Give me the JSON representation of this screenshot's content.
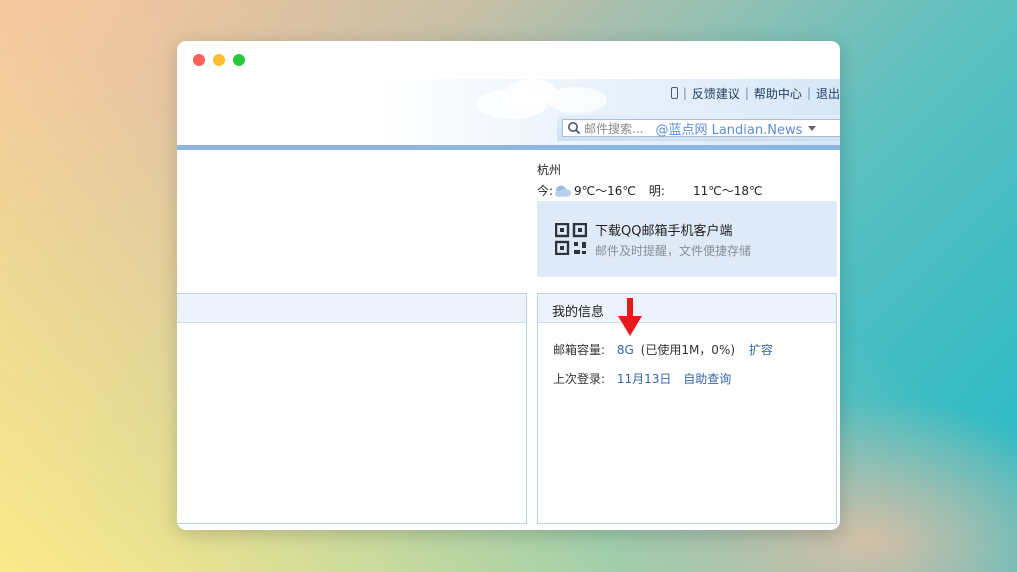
{
  "top_links": {
    "phone_icon": "phone-icon",
    "separator": "|",
    "feedback": "反馈建议",
    "help": "帮助中心",
    "logout": "退出"
  },
  "search": {
    "placeholder": "邮件搜索...",
    "watermark": "@蓝点网 Landian.News"
  },
  "weather": {
    "city": "杭州",
    "today_label": "今:",
    "today_icon": "cloud-icon",
    "today_temp": "9℃～16℃",
    "tomorrow_label": "明:",
    "tomorrow_temp": "11℃～18℃"
  },
  "app_promo": {
    "icon": "qr-code-icon",
    "title": "下载QQ邮箱手机客户端",
    "subtitle": "邮件及时提醒，文件便捷存储"
  },
  "my_info": {
    "title": "我的信息",
    "capacity_label": "邮箱容量:",
    "capacity_value": "8G",
    "capacity_usage": "(已使用1M，0%)",
    "expand_link": "扩容",
    "last_login_label": "上次登录:",
    "last_login_value": "11月13日",
    "self_query_link": "自助查询"
  },
  "colors": {
    "accent_blue": "#3466a5",
    "header_bar": "#8fb5e3",
    "annotation_arrow": "#e8191b"
  }
}
